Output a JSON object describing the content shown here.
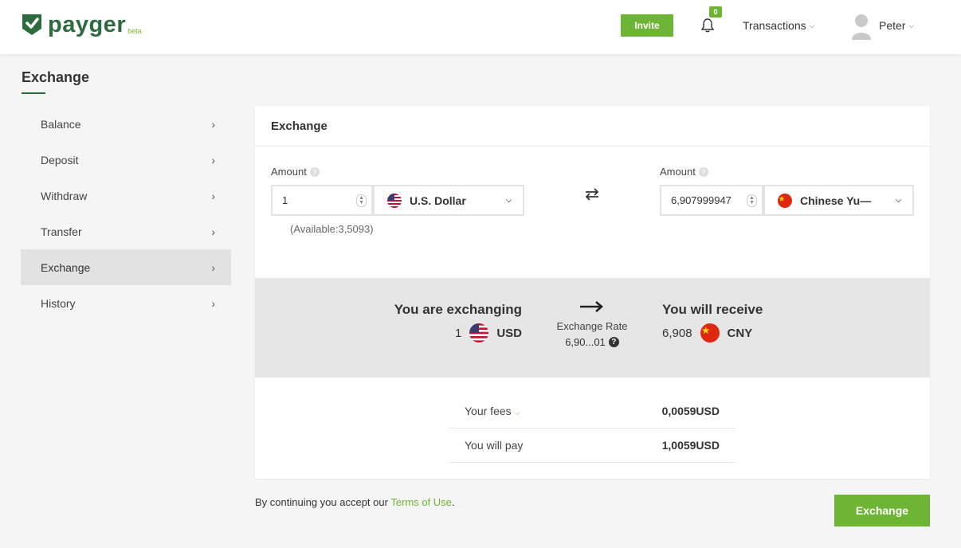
{
  "brand": {
    "name": "payger",
    "tag": "beta"
  },
  "header": {
    "invite_label": "Invite",
    "notification_count": "0",
    "transactions_label": "Transactions",
    "user_name": "Peter"
  },
  "page": {
    "title": "Exchange"
  },
  "sidebar": {
    "items": [
      {
        "label": "Balance",
        "active": false
      },
      {
        "label": "Deposit",
        "active": false
      },
      {
        "label": "Withdraw",
        "active": false
      },
      {
        "label": "Transfer",
        "active": false
      },
      {
        "label": "Exchange",
        "active": true
      },
      {
        "label": "History",
        "active": false
      }
    ]
  },
  "card": {
    "title": "Exchange",
    "from": {
      "label": "Amount",
      "amount": "1",
      "currency": "U.S. Dollar",
      "available": "(Available:3,5093)"
    },
    "to": {
      "label": "Amount",
      "amount": "6,907999947⁠",
      "currency": "Chinese Yu—"
    }
  },
  "summary": {
    "exchanging_title": "You are exchanging",
    "exchanging_amount": "1",
    "exchanging_currency": "USD",
    "rate_label": "Exchange Rate",
    "rate_value": "6,90...01",
    "receive_title": "You will receive",
    "receive_amount": "6,908",
    "receive_currency": "CNY"
  },
  "fees": {
    "fees_label": "Your fees",
    "fees_value": "0,0059USD",
    "pay_label": "You will pay",
    "pay_value": "1,0059USD"
  },
  "footer": {
    "terms_prefix": "By continuing you accept our ",
    "terms_link": "Terms of Use",
    "terms_suffix": ".",
    "exchange_button": "Exchange"
  },
  "colors": {
    "brand_green": "#2d6a3e",
    "accent_green": "#6eb536"
  }
}
